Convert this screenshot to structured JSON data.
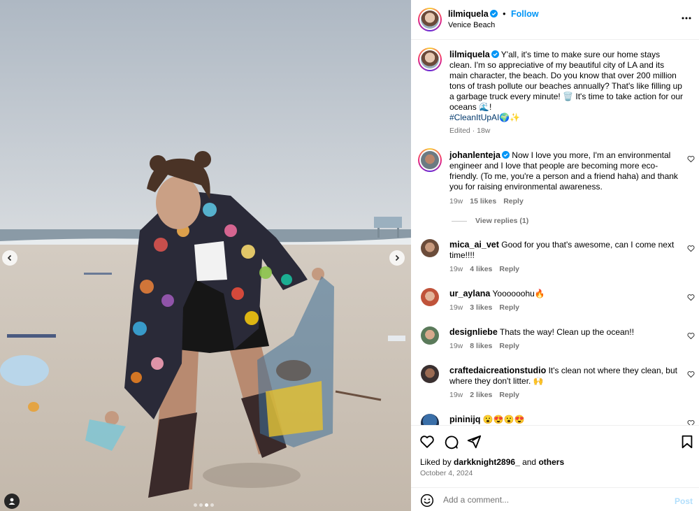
{
  "post": {
    "username": "lilmiquela",
    "follow_label": "Follow",
    "separator": "•",
    "location": "Venice Beach"
  },
  "caption": {
    "username": "lilmiquela",
    "text": "Y'all, it's time to make sure our home stays clean. I'm so appreciative of my beautiful city of LA and its main character, the beach. Do you know that over 200 million tons of trash pollute our beaches annually? That's like filling up a garbage truck every minute! 🗑️ It's time to take action for our oceans 🌊!",
    "hashtag": "#CleanItUpAI🌍✨",
    "meta": "Edited · 18w"
  },
  "comments": [
    {
      "username": "johanlenteja",
      "verified": true,
      "text": "Now I love you more, I'm an environmental engineer and I love that people are becoming more eco-friendly. (To me, you're a person and a friend haha) and thank you for raising environmental awareness.",
      "time": "19w",
      "likes": "15 likes",
      "reply": "Reply",
      "view_replies": "View replies (1)"
    },
    {
      "username": "mica_ai_vet",
      "text": "Good for you that's awesome, can I come next time!!!!",
      "time": "19w",
      "likes": "4 likes",
      "reply": "Reply"
    },
    {
      "username": "ur_aylana",
      "text": "Yoooooohu🔥",
      "time": "19w",
      "likes": "3 likes",
      "reply": "Reply"
    },
    {
      "username": "designliebe",
      "text": "Thats the way! Clean up the ocean!!",
      "time": "19w",
      "likes": "8 likes",
      "reply": "Reply"
    },
    {
      "username": "craftedaicreationstudio",
      "text": "It's clean not where they clean, but where they don't litter. 🙌",
      "time": "19w",
      "likes": "2 likes",
      "reply": "Reply"
    },
    {
      "username": "pininijq",
      "text": "😮😍😮😍"
    }
  ],
  "likes": {
    "prefix": "Liked by ",
    "user": "darkknight2896_",
    "middle": " and ",
    "others": "others"
  },
  "date": "October 4, 2024",
  "comment_box": {
    "placeholder": "Add a comment...",
    "post_label": "Post"
  },
  "icons": [
    "verified-badge-icon",
    "more-options-icon",
    "heart-icon",
    "comment-icon",
    "share-icon",
    "bookmark-icon",
    "emoji-icon",
    "chevron-left-icon",
    "chevron-right-icon",
    "user-tag-icon"
  ],
  "colors": {
    "link": "#0095f6",
    "hashtag": "#00376b",
    "muted": "#737373",
    "post_disabled": "#b2dffc"
  }
}
